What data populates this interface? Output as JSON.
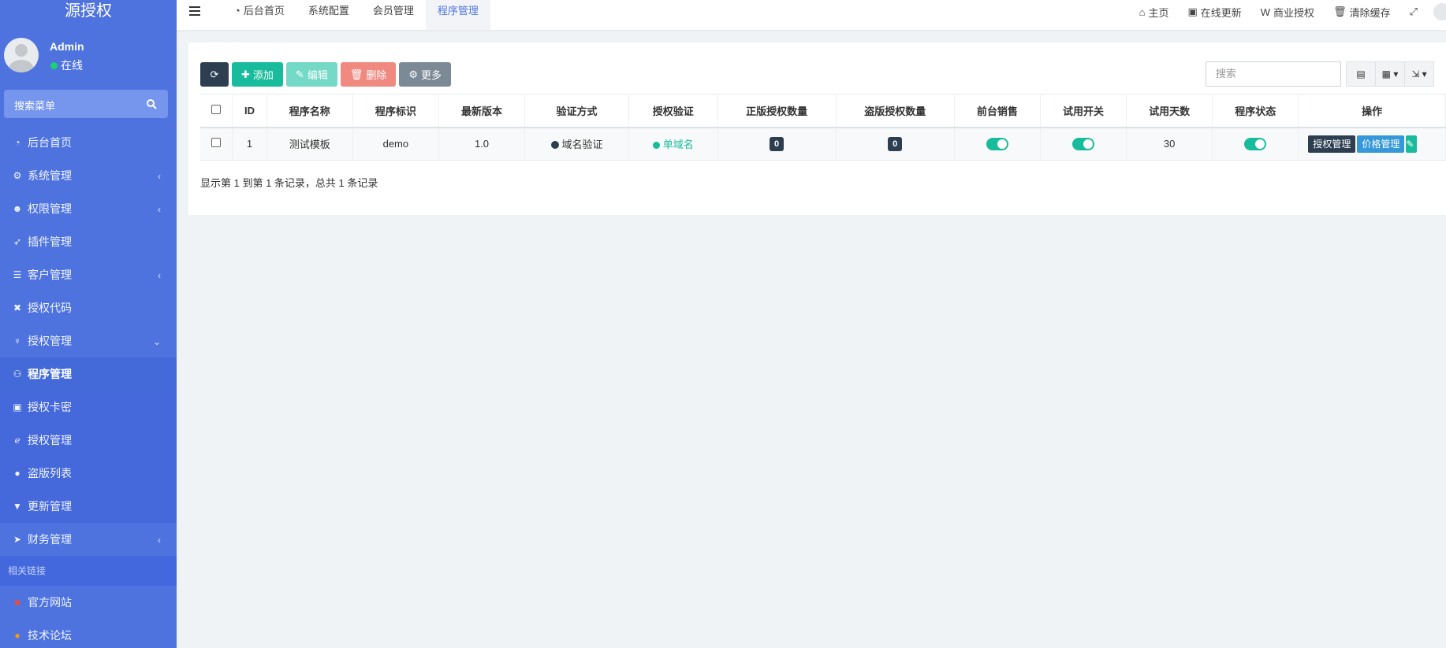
{
  "brand": "源授权",
  "user": {
    "name": "Admin",
    "status": "在线"
  },
  "sidebar": {
    "search_placeholder": "搜索菜单",
    "items": [
      {
        "label": "后台首页",
        "icon": "dashboard-icon"
      },
      {
        "label": "系统管理",
        "icon": "cogs-icon"
      },
      {
        "label": "权限管理",
        "icon": "group-icon"
      },
      {
        "label": "插件管理",
        "icon": "rocket-icon"
      },
      {
        "label": "客户管理",
        "icon": "list-icon"
      },
      {
        "label": "授权代码",
        "icon": "code-icon"
      },
      {
        "label": "授权管理",
        "icon": "gitlab-icon"
      },
      {
        "label": "程序管理",
        "icon": "car-icon"
      },
      {
        "label": "授权卡密",
        "icon": "id-card-icon"
      },
      {
        "label": "授权管理",
        "icon": "ie-icon"
      },
      {
        "label": "盗版列表",
        "icon": "user-secret-icon"
      },
      {
        "label": "更新管理",
        "icon": "vimeo-icon"
      },
      {
        "label": "财务管理",
        "icon": "paper-plane-icon"
      }
    ],
    "section_header": "相关链接",
    "links": [
      {
        "label": "官方网站",
        "icon": "flag-icon",
        "color": "#e74c3c"
      },
      {
        "label": "技术论坛",
        "icon": "comment-icon",
        "color": "#f39c12"
      }
    ]
  },
  "topnav": {
    "tabs": [
      {
        "label": "后台首页"
      },
      {
        "label": "系统配置"
      },
      {
        "label": "会员管理"
      },
      {
        "label": "程序管理"
      }
    ],
    "right": [
      {
        "label": "主页",
        "icon": "home-icon"
      },
      {
        "label": "在线更新",
        "icon": "vimeo-icon"
      },
      {
        "label": "商业授权",
        "icon": "wikipedia-icon"
      },
      {
        "label": "清除缓存",
        "icon": "trash-icon"
      }
    ]
  },
  "toolbar": {
    "add": "添加",
    "edit": "编辑",
    "delete": "删除",
    "more": "更多",
    "search_placeholder": "搜索"
  },
  "table": {
    "headers": [
      "ID",
      "程序名称",
      "程序标识",
      "最新版本",
      "验证方式",
      "授权验证",
      "正版授权数量",
      "盗版授权数量",
      "前台销售",
      "试用开关",
      "试用天数",
      "程序状态",
      "操作"
    ],
    "row": {
      "id": "1",
      "name": "测试模板",
      "ident": "demo",
      "version": "1.0",
      "verify_method": "域名验证",
      "auth_verify": "单域名",
      "genuine_count": "0",
      "pirate_count": "0",
      "trial_days": "30",
      "front_sale": true,
      "trial_switch": true,
      "status": true,
      "actions": [
        "授权管理",
        "价格管理"
      ]
    }
  },
  "pager_text": "显示第 1 到第 1 条记录，总共 1 条记录",
  "colors": {
    "sidebar": "#4e73df",
    "success": "#18bc9c",
    "dark": "#2c3e50",
    "info": "#3498db"
  }
}
